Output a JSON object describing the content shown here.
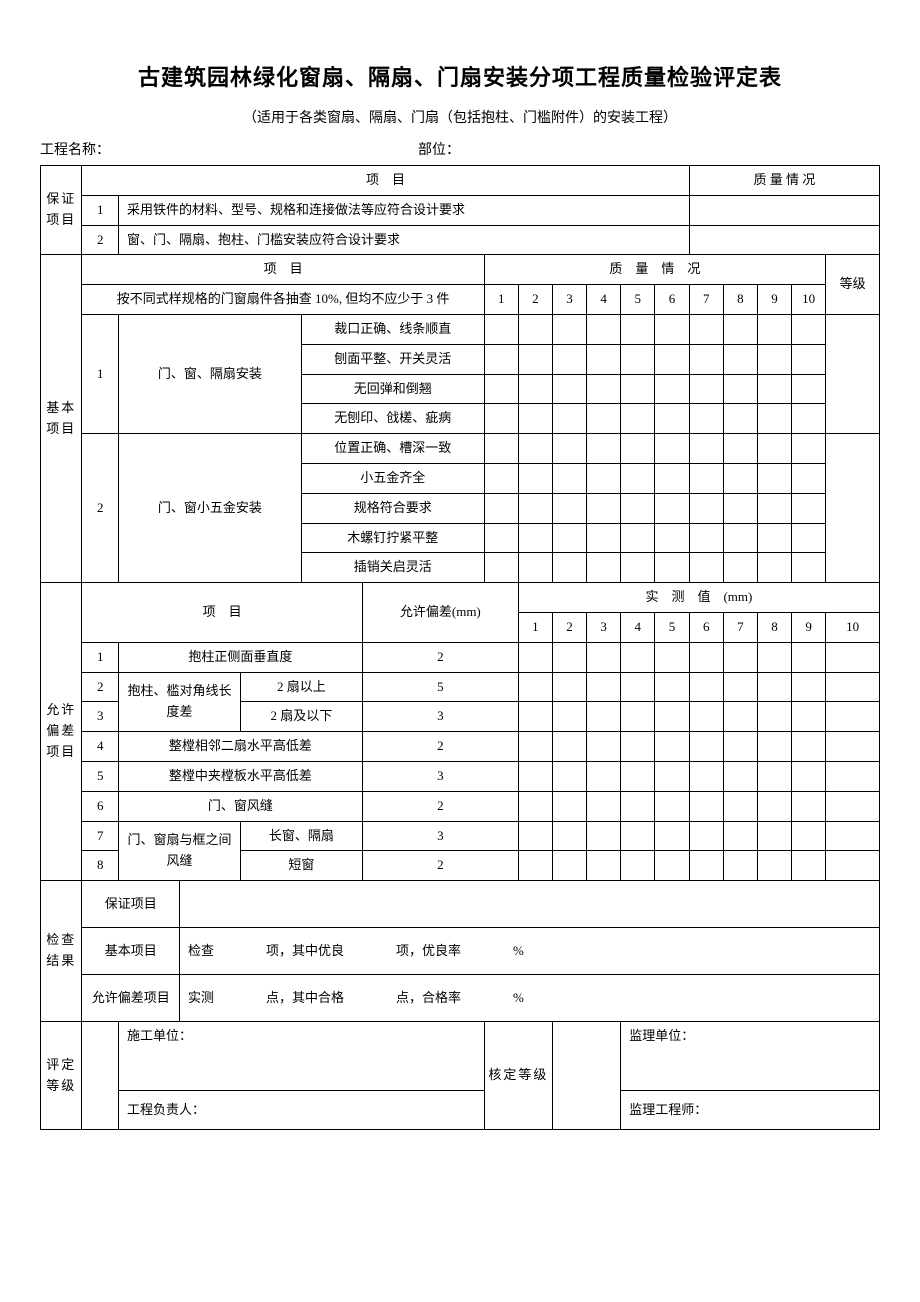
{
  "title": "古建筑园林绿化窗扇、隔扇、门扇安装分项工程质量检验评定表",
  "subtitle": "（适用于各类窗扇、隔扇、门扇（包括抱柱、门槛附件）的安装工程）",
  "header": {
    "project_label": "工程名称：",
    "section_label": "部位："
  },
  "guarantee": {
    "section_label": "保证项目",
    "col_project": "项　目",
    "col_quality": "质 量 情 况",
    "rows": [
      {
        "num": "1",
        "text": "采用铁件的材料、型号、规格和连接做法等应符合设计要求"
      },
      {
        "num": "2",
        "text": "窗、门、隔扇、抱柱、门槛安装应符合设计要求"
      }
    ]
  },
  "basic": {
    "section_label": "基本项目",
    "col_project": "项　目",
    "col_quality": "质　量　情　况",
    "col_grade": "等级",
    "sample_note": "按不同式样规格的门窗扇件各抽查 10%, 但均不应少于 3 件",
    "nums": [
      "1",
      "2",
      "3",
      "4",
      "5",
      "6",
      "7",
      "8",
      "9",
      "10"
    ],
    "group1": {
      "num": "1",
      "label": "门、窗、隔扇安装",
      "items": [
        "裁口正确、线条顺直",
        "刨面平整、开关灵活",
        "无回弹和倒翘",
        "无刨印、戗槎、疵病"
      ]
    },
    "group2": {
      "num": "2",
      "label": "门、窗小五金安装",
      "items": [
        "位置正确、槽深一致",
        "小五金齐全",
        "规格符合要求",
        "木螺钉拧紧平整",
        "插销关启灵活"
      ]
    }
  },
  "tolerance": {
    "section_label": "允许偏差项目",
    "col_project": "项　目",
    "col_allow": "允许偏差(mm)",
    "col_measured": "实　测　值　(mm)",
    "nums": [
      "1",
      "2",
      "3",
      "4",
      "5",
      "6",
      "7",
      "8",
      "9",
      "10"
    ],
    "rows": [
      {
        "num": "1",
        "name": "抱柱正侧面垂直度",
        "sub": "",
        "allow": "2"
      },
      {
        "num": "2",
        "name": "抱柱、槛对角线长度差",
        "sub": "2 扇以上",
        "allow": "5"
      },
      {
        "num": "3",
        "name": "",
        "sub": "2 扇及以下",
        "allow": "3"
      },
      {
        "num": "4",
        "name": "整樘相邻二扇水平高低差",
        "sub": "",
        "allow": "2"
      },
      {
        "num": "5",
        "name": "整樘中夹樘板水平高低差",
        "sub": "",
        "allow": "3"
      },
      {
        "num": "6",
        "name": "门、窗风缝",
        "sub": "",
        "allow": "2"
      },
      {
        "num": "7",
        "name": "门、窗扇与框之间风缝",
        "sub": "长窗、隔扇",
        "allow": "3"
      },
      {
        "num": "8",
        "name": "",
        "sub": "短窗",
        "allow": "2"
      }
    ]
  },
  "result": {
    "section_label": "检查结果",
    "guarantee_label": "保证项目",
    "basic_label": "基本项目",
    "basic_text": "检查　　　　项，其中优良　　　　项，优良率　　　　%",
    "tolerance_label": "允许偏差项目",
    "tolerance_text": "实测　　　　点，其中合格　　　　点，合格率　　　　%"
  },
  "eval": {
    "section_label": "评定等级",
    "contractor_label": "施工单位：",
    "manager_label": "工程负责人：",
    "verify_label": "核定等级",
    "supervisor_label": "监理单位：",
    "engineer_label": "监理工程师："
  }
}
